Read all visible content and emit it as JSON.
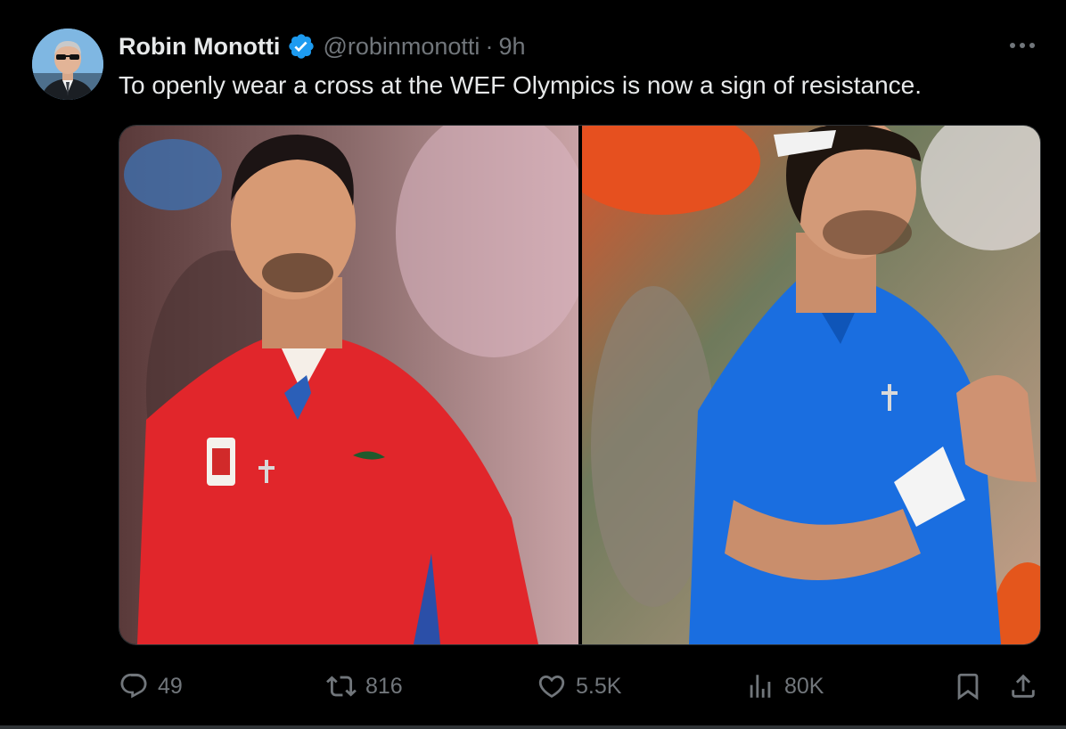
{
  "tweet": {
    "author": {
      "display_name": "Robin Monotti",
      "handle": "@robinmonotti",
      "verified": true
    },
    "separator": "·",
    "timestamp": "9h",
    "text": "To openly wear a cross at the WEF Olympics is now a sign of resistance.",
    "media": [
      {
        "description": "tennis player in red Serbia shirt with cross necklace"
      },
      {
        "description": "tennis player in blue Italy shirt with cross necklace"
      }
    ],
    "stats": {
      "replies": "49",
      "reposts": "816",
      "likes": "5.5K",
      "views": "80K"
    }
  },
  "icons": {
    "verified": "verified-badge-icon",
    "more": "more-dots-icon",
    "reply": "reply-icon",
    "repost": "repost-icon",
    "like": "heart-icon",
    "views": "views-bar-chart-icon",
    "bookmark": "bookmark-icon",
    "share": "share-icon"
  },
  "colors": {
    "background": "#000000",
    "text_primary": "#e7e9ea",
    "text_secondary": "#71767b",
    "verified_blue": "#1d9bf0",
    "border": "#2f3336"
  }
}
